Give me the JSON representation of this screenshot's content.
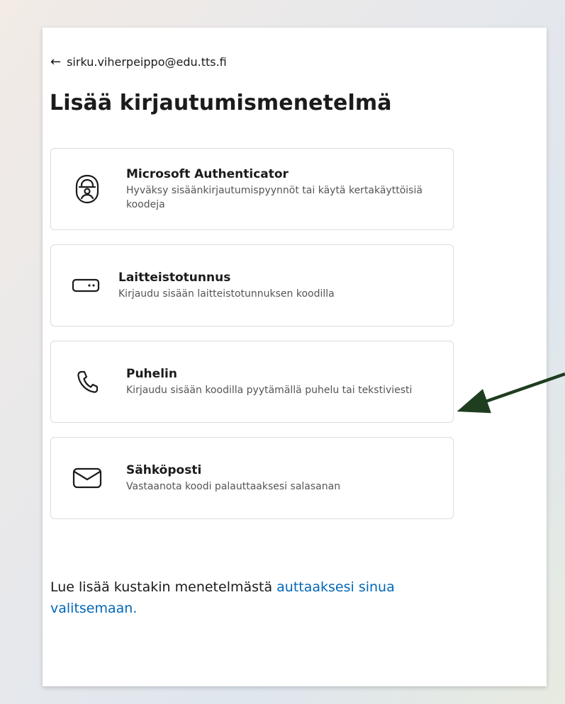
{
  "header": {
    "back_arrow": "←",
    "account": "sirku.viherpeippo@edu.tts.fi",
    "title": "Lisää kirjautumismenetelmä"
  },
  "methods": [
    {
      "icon": "authenticator-lock-icon",
      "name": "Microsoft Authenticator",
      "description": "Hyväksy sisäänkirjautumispyynnöt tai käytä kertakäyttöisiä koodeja"
    },
    {
      "icon": "hardware-token-icon",
      "name": "Laitteistotunnus",
      "description": "Kirjaudu sisään laitteistotunnuksen koodilla"
    },
    {
      "icon": "phone-icon",
      "name": "Puhelin",
      "description": "Kirjaudu sisään koodilla pyytämällä puhelu tai tekstiviesti"
    },
    {
      "icon": "envelope-icon",
      "name": "Sähköposti",
      "description": "Vastaanota koodi palauttaaksesi salasanan"
    }
  ],
  "footer": {
    "text": "Lue lisää kustakin menetelmästä ",
    "link": "auttaaksesi sinua valitsemaan."
  },
  "colors": {
    "link": "#0067b8",
    "annotation_arrow": "#1f3d1f"
  }
}
